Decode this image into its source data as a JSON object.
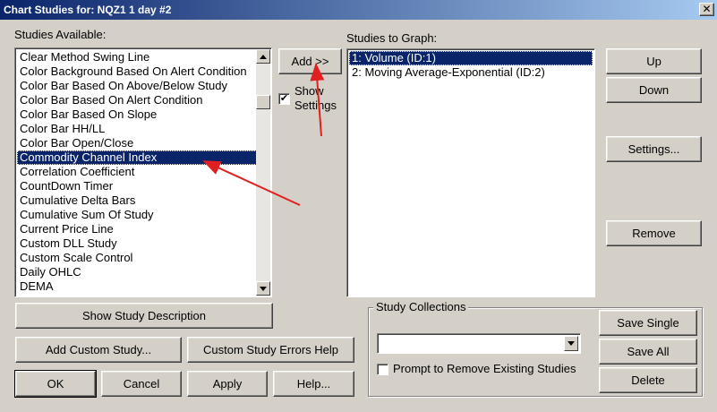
{
  "window": {
    "title": "Chart Studies for: NQZ1  1 day  #2",
    "close_glyph": "✕"
  },
  "studies_available": {
    "label": "Studies Available:",
    "items": [
      "Clear Method Swing Line",
      "Color Background Based On Alert Condition",
      "Color Bar Based On Above/Below Study",
      "Color Bar Based On Alert Condition",
      "Color Bar Based On Slope",
      "Color Bar HH/LL",
      "Color Bar Open/Close",
      "Commodity Channel Index",
      "Correlation Coefficient",
      "CountDown Timer",
      "Cumulative Delta Bars",
      "Cumulative Sum Of Study",
      "Current Price Line",
      "Custom DLL Study",
      "Custom Scale Control",
      "Daily OHLC",
      "DEMA"
    ],
    "selected_index": 7
  },
  "add_button": {
    "label": "Add >>"
  },
  "show_settings": {
    "label_line1": "Show",
    "label_line2": "Settings",
    "checked": true,
    "check_glyph": "✔"
  },
  "studies_to_graph": {
    "label": "Studies to Graph:",
    "items": [
      "1: Volume (ID:1)",
      "2: Moving Average-Exponential (ID:2)"
    ],
    "selected_index": 0
  },
  "right_buttons": {
    "up": "Up",
    "down": "Down",
    "settings": "Settings...",
    "remove": "Remove"
  },
  "bottom_buttons": {
    "show_description": "Show Study Description",
    "add_custom": "Add Custom Study...",
    "custom_errors": "Custom Study Errors Help",
    "ok": "OK",
    "cancel": "Cancel",
    "apply": "Apply",
    "help": "Help..."
  },
  "collections": {
    "label": "Study Collections",
    "combo_value": "",
    "prompt_label": "Prompt to Remove Existing Studies",
    "prompt_checked": false,
    "save_single": "Save Single",
    "save_all": "Save All",
    "delete": "Delete"
  },
  "annotation": {
    "arrow_color": "#e02020"
  }
}
